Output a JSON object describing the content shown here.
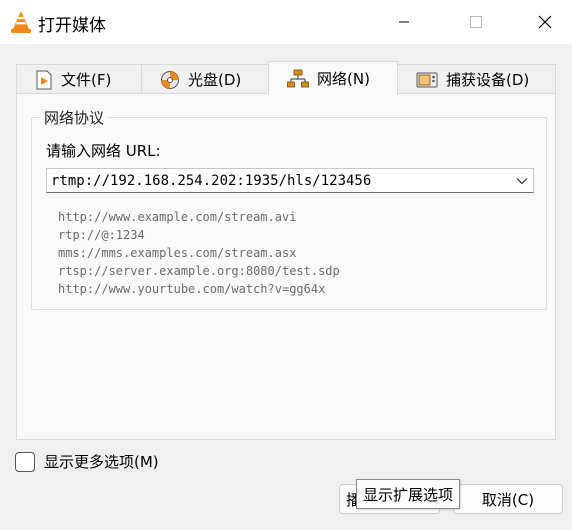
{
  "window": {
    "title": "打开媒体"
  },
  "tabs": [
    {
      "label": "文件(F)",
      "icon": "file-icon"
    },
    {
      "label": "光盘(D)",
      "icon": "disc-icon"
    },
    {
      "label": "网络(N)",
      "icon": "network-icon",
      "active": true
    },
    {
      "label": "捕获设备(D)",
      "icon": "capture-device-icon"
    }
  ],
  "network": {
    "group_title": "网络协议",
    "url_label": "请输入网络 URL:",
    "url_value": "rtmp://192.168.254.202:1935/hls/123456",
    "examples": [
      "http://www.example.com/stream.avi",
      "rtp://@:1234",
      "mms://mms.examples.com/stream.asx",
      "rtsp://server.example.org:8080/test.sdp",
      "http://www.yourtube.com/watch?v=gg64x"
    ]
  },
  "options": {
    "show_more_label": "显示更多选项(M)",
    "checked": false
  },
  "buttons": {
    "play_partial": "播",
    "cancel": "取消(C)"
  },
  "tooltip": {
    "text": "显示扩展选项"
  },
  "colors": {
    "accent_orange": "#f08a1c",
    "network_icon": "#d98b1e"
  }
}
